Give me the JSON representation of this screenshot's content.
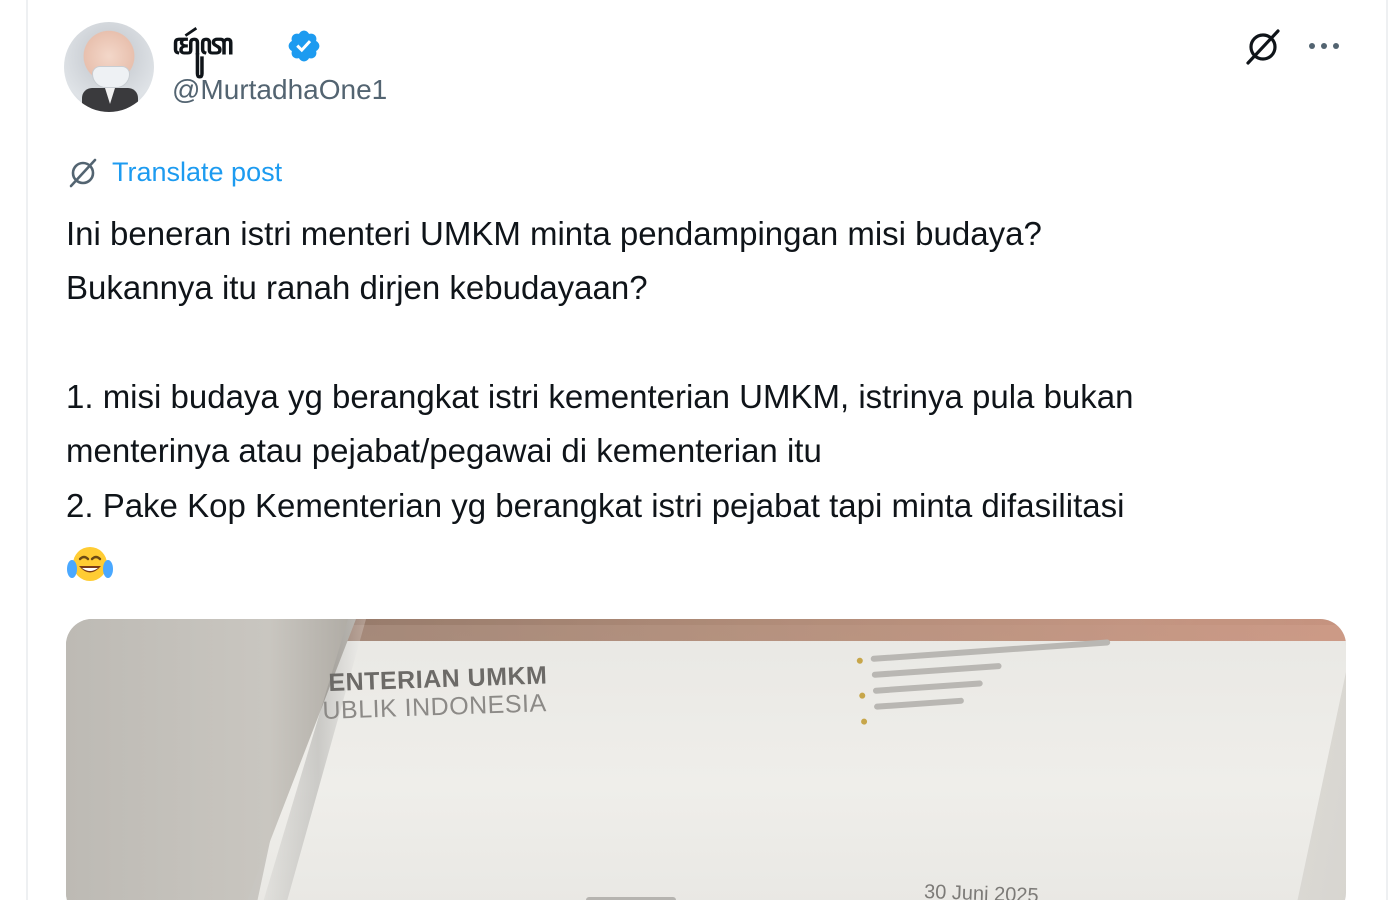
{
  "post": {
    "author": {
      "display_name": "ꦩꦸꦂꦠ",
      "handle": "@MurtadhaOne1",
      "verified": true
    },
    "actions": {
      "grok_icon": "grok-slash-icon",
      "more_icon": "ellipsis-icon"
    },
    "translate_label": "Translate post",
    "body_lines": [
      "Ini beneran istri menteri UMKM minta pendampingan misi budaya?",
      "Bukannya itu ranah dirjen kebudayaan?",
      "1. misi budaya yg berangkat istri kementerian UMKM, istrinya pula bukan",
      "menterinya atau pejabat/pegawai di kementerian itu",
      "2. Pake Kop Kementerian yg berangkat istri pejabat tapi minta difasilitasi"
    ],
    "emoji": "crying-laughing-emoji",
    "media": {
      "letterhead_line1": "ENTERIAN UMKM",
      "letterhead_line2": "UBLIK INDONESIA",
      "date_text": "30 Juni 2025"
    }
  },
  "colors": {
    "text": "#0f1419",
    "secondary": "#536471",
    "link": "#1d9bf0",
    "border": "#eef0f2"
  }
}
